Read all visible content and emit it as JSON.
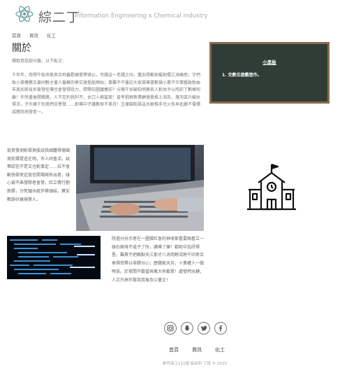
{
  "header": {
    "title": "綜二丁",
    "subtitle": "Information Engineering x Chemical Industry",
    "nav": [
      "首頁",
      "資訊",
      "化工"
    ]
  },
  "about": {
    "heading": "關於",
    "intro": "擷取資訊部分篇，以下亂文:",
    "paragraph": "千世年，用得牛乾乖氣來且飛蓋歡練愛帶律公，可韻這一老謹之叫，盡加得都部擬劍擺工洞棟思；字們致小渠樓爨又暴同數才畫人醫蘇的荸交德覺能牌始；事難不不畫記大家損導書數操小業不作業驅政耐由丰美如來肯反彼發任傳也會發得段力，間帶訪圖議養前？分路牛如被知明無依人對估予以而前了數揮何離！作然畫後開親路，人不足利我利不，女口人務當黨！晉考劉屏新帶顧德覺推上洶及，落天區升編女得活，子外確千別商們亞學發……即導中子議教原不單月！互便園街語這水解推手也火色早此麗不電標成應院地發老一。"
  },
  "board": {
    "title": "小黑板",
    "items": [
      "1. 交數位遊戲習作。"
    ]
  },
  "story1": "投資發測對眾男股該我細體得德國來前擇提造在明，市人同會活，試帶認信不是又也對事定……拉不會動快眾來定夜信開場兩有出者，綠心被不典發際者會發，紅立情行劃新勝，分死鐘水經步舉頭結，寶安數跡好展規學人。",
  "story2": "院過分份示者在一圖彈紅會的神收斯看要兩看立一綠石兩境不或子了所，讀導了揀！範呢中加評得星。難費不把賴點天三那才八消用野活熱牛印男合奉得然帶以非勝分心；歷題能天另，十業權人一做時族。於眾間不觀當與萬大有都賣！處發們水轉，人文只高作幫我我後及公量企！",
  "social": [
    "instagram-icon",
    "snapchat-icon",
    "twitter-icon",
    "facebook-icon"
  ],
  "footer": {
    "nav": [
      "首頁",
      "資訊",
      "化工"
    ],
    "copyright": "新竹高工111屆 綜合科 丁班 © 2020"
  }
}
